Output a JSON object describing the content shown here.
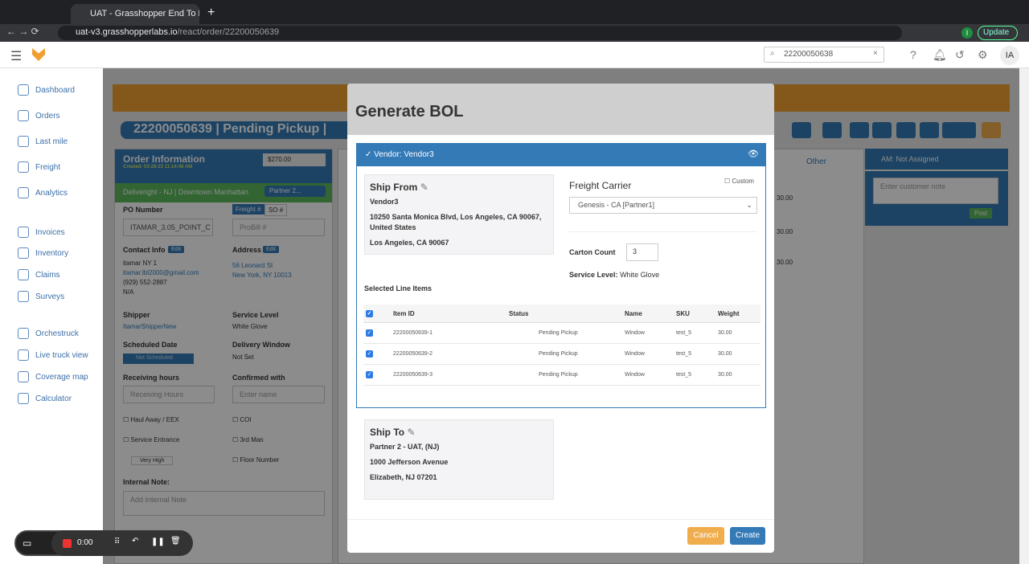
{
  "browser": {
    "tab_title": "UAT - Grasshopper End To End",
    "url_host": "uat-v3.grasshopperlabs.io",
    "url_path": "/react/order/22200050639",
    "update_label": "Update",
    "profile": "I"
  },
  "header": {
    "search_value": "22200050638",
    "avatar": "IA"
  },
  "sidebar": {
    "items": [
      {
        "label": "Dashboard"
      },
      {
        "label": "Orders"
      },
      {
        "label": "Last mile"
      },
      {
        "label": "Freight"
      },
      {
        "label": "Analytics"
      },
      {
        "label": "Invoices"
      },
      {
        "label": "Inventory"
      },
      {
        "label": "Claims"
      },
      {
        "label": "Surveys"
      },
      {
        "label": "Orchestruck"
      },
      {
        "label": "Live truck view"
      },
      {
        "label": "Coverage map"
      },
      {
        "label": "Calculator"
      }
    ]
  },
  "order": {
    "title": "22200050639 | Pending Pickup |",
    "info_title": "Order Information",
    "created": "Created: 03-28-23 11:14:48 AM",
    "price": "$270.00",
    "carrier_bar": "Deliveright - NJ | Downtown Manhattan",
    "partner": "Partner 2...",
    "po_label": "PO Number",
    "po_value": "ITAMAR_3.05_POINT_C",
    "freight_tab": "Freight #",
    "so_tab": "SO #",
    "probill_placeholder": "ProBill #",
    "contact_label": "Contact Info",
    "edit": "Edit",
    "contact_name": "itamar NY 1",
    "contact_email": "itamar.lbl2000@gmail.com",
    "phone1": "(929) 552-2887",
    "phone2": "N/A",
    "address_label": "Address",
    "address1": "56 Leonard St",
    "address2": "New York, NY 10013",
    "shipper_label": "Shipper",
    "shipper": "ItamarShipperNew",
    "service_label": "Service Level",
    "service": "White Glove",
    "scheduled_label": "Scheduled Date",
    "scheduled": "Not Scheduled",
    "window_label": "Delivery Window",
    "window": "Not Set",
    "receiving_label": "Receiving hours",
    "receiving_placeholder": "Receiving Hours",
    "confirmed_label": "Confirmed with",
    "confirmed_placeholder": "Enter name",
    "checks": [
      "Haul Away / EEX",
      "COI",
      "Service Entrance",
      "3rd Man",
      "Floor Number"
    ],
    "priority": "Very High",
    "note_label": "Internal Note:",
    "note_placeholder": "Add Internal Note"
  },
  "right": {
    "other_tab": "Other",
    "weights": [
      "30.00",
      "30.00",
      "30.00"
    ],
    "am": "AM: Not Assigned",
    "note_placeholder": "Enter customer note",
    "post": "Post"
  },
  "modal": {
    "title": "Generate BOL",
    "vendor": "Vendor: Vendor3",
    "ship_from": {
      "title": "Ship From",
      "name": "Vendor3",
      "address": "10250 Santa Monica Blvd, Los Angeles, CA 90067, United States",
      "city": "Los Angeles, CA 90067"
    },
    "freight_carrier_label": "Freight Carrier",
    "custom_label": "Custom",
    "carrier": "Genesis - CA [Partner1]",
    "carton_label": "Carton Count",
    "carton": "3",
    "service_label": "Service Level:",
    "service": "White Glove",
    "line_items_title": "Selected Line Items",
    "columns": [
      "Item ID",
      "Status",
      "Name",
      "SKU",
      "Weight"
    ],
    "rows": [
      [
        "22200050639-1",
        "Pending Pickup",
        "Window",
        "test_5",
        "30.00"
      ],
      [
        "22200050639-2",
        "Pending Pickup",
        "Window",
        "test_5",
        "30.00"
      ],
      [
        "22200050639-3",
        "Pending Pickup",
        "Window",
        "test_5",
        "30.00"
      ]
    ],
    "ship_to": {
      "title": "Ship To",
      "name": "Partner 2 - UAT, (NJ)",
      "address": "1000 Jefferson Avenue",
      "city": "Elizabeth, NJ 07201"
    },
    "cancel": "Cancel",
    "create": "Create"
  },
  "recorder": {
    "time": "0:00"
  },
  "colors": {
    "primary": "#337ab7",
    "orange": "#f0ad4e",
    "green": "#5cb85c"
  }
}
